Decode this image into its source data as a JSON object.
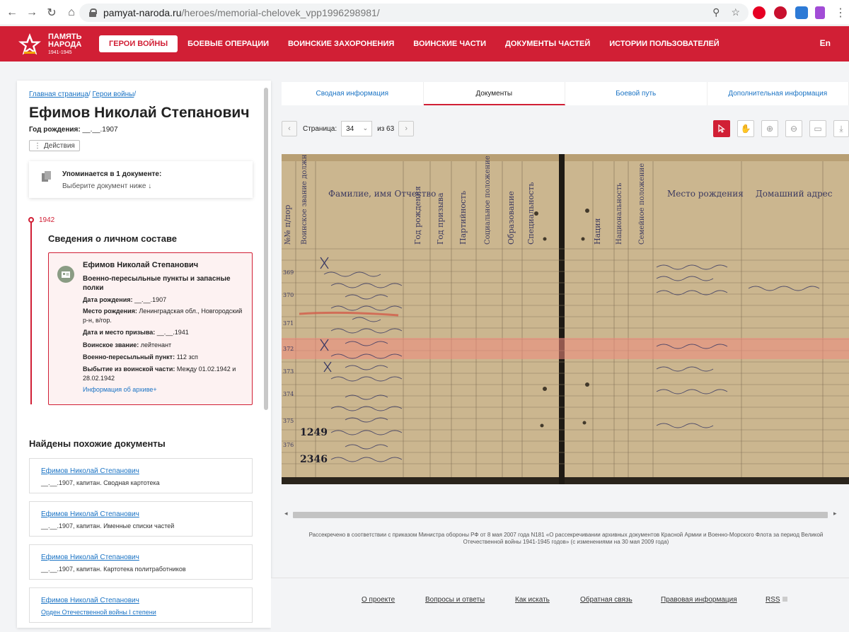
{
  "browser": {
    "url_domain": "pamyat-naroda.ru",
    "url_path": "/heroes/memorial-chelovek_vpp1996298981/",
    "extensions": [
      "pinterest-icon",
      "adblock-plus-icon",
      "cloud-extension-icon",
      "pen-extension-icon"
    ]
  },
  "header": {
    "logo_line1": "ПАМЯТЬ",
    "logo_line2": "НАРОДА",
    "logo_years": "1941-1945",
    "nav": [
      "ГЕРОИ ВОЙНЫ",
      "БОЕВЫЕ ОПЕРАЦИИ",
      "ВОИНСКИЕ ЗАХОРОНЕНИЯ",
      "ВОИНСКИЕ ЧАСТИ",
      "ДОКУМЕНТЫ ЧАСТЕЙ",
      "ИСТОРИИ ПОЛЬЗОВАТЕЛЕЙ"
    ],
    "lang": "En",
    "brand_color": "#d11f35"
  },
  "left": {
    "breadcrumb": [
      "Главная страница",
      "Герои войны"
    ],
    "hero_name": "Ефимов Николай Степанович",
    "birth_label": "Год рождения:",
    "birth_value": "__.__.1907",
    "actions_label": "Действия",
    "mention_title": "Упоминается в 1 документе:",
    "mention_sub": "Выберите документ ниже ↓",
    "timeline_year": "1942",
    "section_title": "Сведения о личном составе",
    "record": {
      "name": "Ефимов Николай Степанович",
      "unit": "Военно-пересыльные пункты и запасные полки",
      "rows": [
        {
          "label": "Дата рождения:",
          "value": "__.__.1907"
        },
        {
          "label": "Место рождения:",
          "value": "Ленинградская обл., Новгородский р-н, в/гор."
        },
        {
          "label": "Дата и место призыва:",
          "value": "__.__.1941"
        },
        {
          "label": "Воинское звание:",
          "value": "лейтенант"
        },
        {
          "label": "Военно-пересыльный пункт:",
          "value": "112 зсп"
        },
        {
          "label": "Выбытие из воинской части:",
          "value": "Между 01.02.1942 и 28.02.1942"
        }
      ],
      "archive_link": "Информация об архиве+"
    },
    "similar_title": "Найдены похожие документы",
    "similar": [
      {
        "link": "Ефимов Николай Степанович",
        "desc": "__.__.1907, капитан. Сводная картотека"
      },
      {
        "link": "Ефимов Николай Степанович",
        "desc": "__.__.1907, капитан. Именные списки частей"
      },
      {
        "link": "Ефимов Николай Степанович",
        "desc": "__.__.1907, капитан. Картотека политработников"
      },
      {
        "link": "Ефимов Николай Степанович",
        "desc": "Орден Отечественной войны I степени"
      }
    ]
  },
  "right": {
    "tabs": [
      "Сводная информация",
      "Документы",
      "Боевой путь",
      "Дополнительная информация"
    ],
    "active_tab": "Документы",
    "page_label": "Страница:",
    "page_value": "34",
    "page_of": "из 63",
    "tools": [
      "cursor-icon",
      "hand-icon",
      "zoom-in-icon",
      "zoom-out-icon",
      "monitor-icon",
      "download-icon"
    ],
    "notice": "Рассекречено в соответствии с приказом Министра обороны РФ от 8 мая 2007 года N181 «О рассекречивании архивных документов Красной Армии и Военно-Морского Флота за период Великой Отечественной войны 1941-1945 годов» (с изменениями на 30 мая 2009 года)"
  },
  "document": {
    "headers_left": [
      "№№ п/пор",
      "Воинское звание должность",
      "Фамилие, имя Отчество",
      "Год рождения",
      "Год призыва",
      "Партийность",
      "Социальное положение",
      "Образование",
      "Специальность"
    ],
    "headers_right": [
      "Нация",
      "Национальность",
      "Семейное положение",
      "Место рождения",
      "Домашний адрес"
    ],
    "row_numbers": [
      "369",
      "370",
      "371",
      "372",
      "373",
      "374",
      "375",
      "376"
    ],
    "stamps": [
      "1249",
      "2346"
    ]
  },
  "footer": {
    "links": [
      "О проекте",
      "Вопросы и ответы",
      "Как искать",
      "Обратная связь",
      "Правовая информация",
      "RSS"
    ]
  }
}
